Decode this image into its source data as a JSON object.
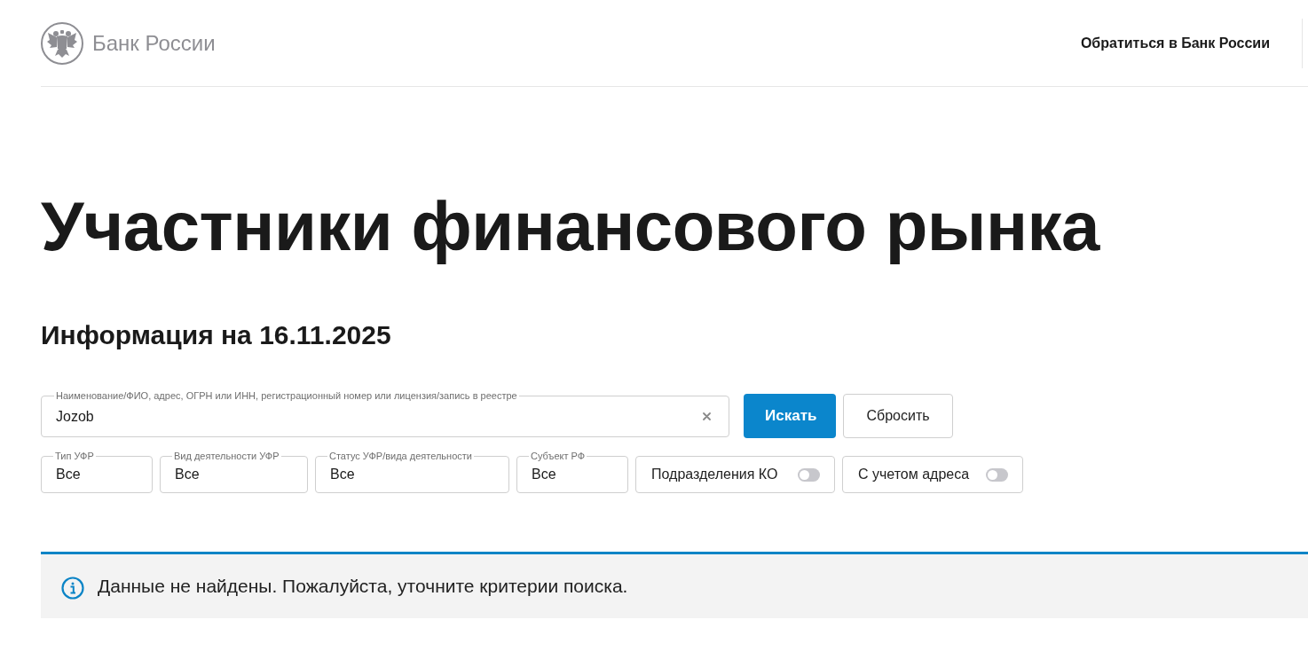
{
  "header": {
    "logo_text": "Банк России",
    "contact_link": "Обратиться в Банк России"
  },
  "page_title": "Участники финансового рынка",
  "info_heading": "Информация на 16.11.2025",
  "search": {
    "label": "Наименование/ФИО, адрес, ОГРН или ИНН, регистрационный номер или лицензия/запись в реестре",
    "value": "Jozob"
  },
  "buttons": [
    {
      "kind": "primary",
      "label": "Искать"
    },
    {
      "kind": "secondary",
      "label": "Сбросить"
    }
  ],
  "filters": [
    {
      "kind": "select",
      "label": "Тип УФР",
      "value": "Все"
    },
    {
      "kind": "select",
      "label": "Вид деятельности УФР",
      "value": "Все"
    },
    {
      "kind": "select",
      "label": "Статус УФР/вида деятельности",
      "value": "Все"
    },
    {
      "kind": "select",
      "label": "Субъект РФ",
      "value": "Все"
    },
    {
      "kind": "toggle",
      "label": "Подразделения КО",
      "on": false
    },
    {
      "kind": "toggle",
      "label": "С учетом адреса",
      "on": false
    }
  ],
  "alert": {
    "text": "Данные не найдены. Пожалуйста, уточните критерии поиска."
  }
}
